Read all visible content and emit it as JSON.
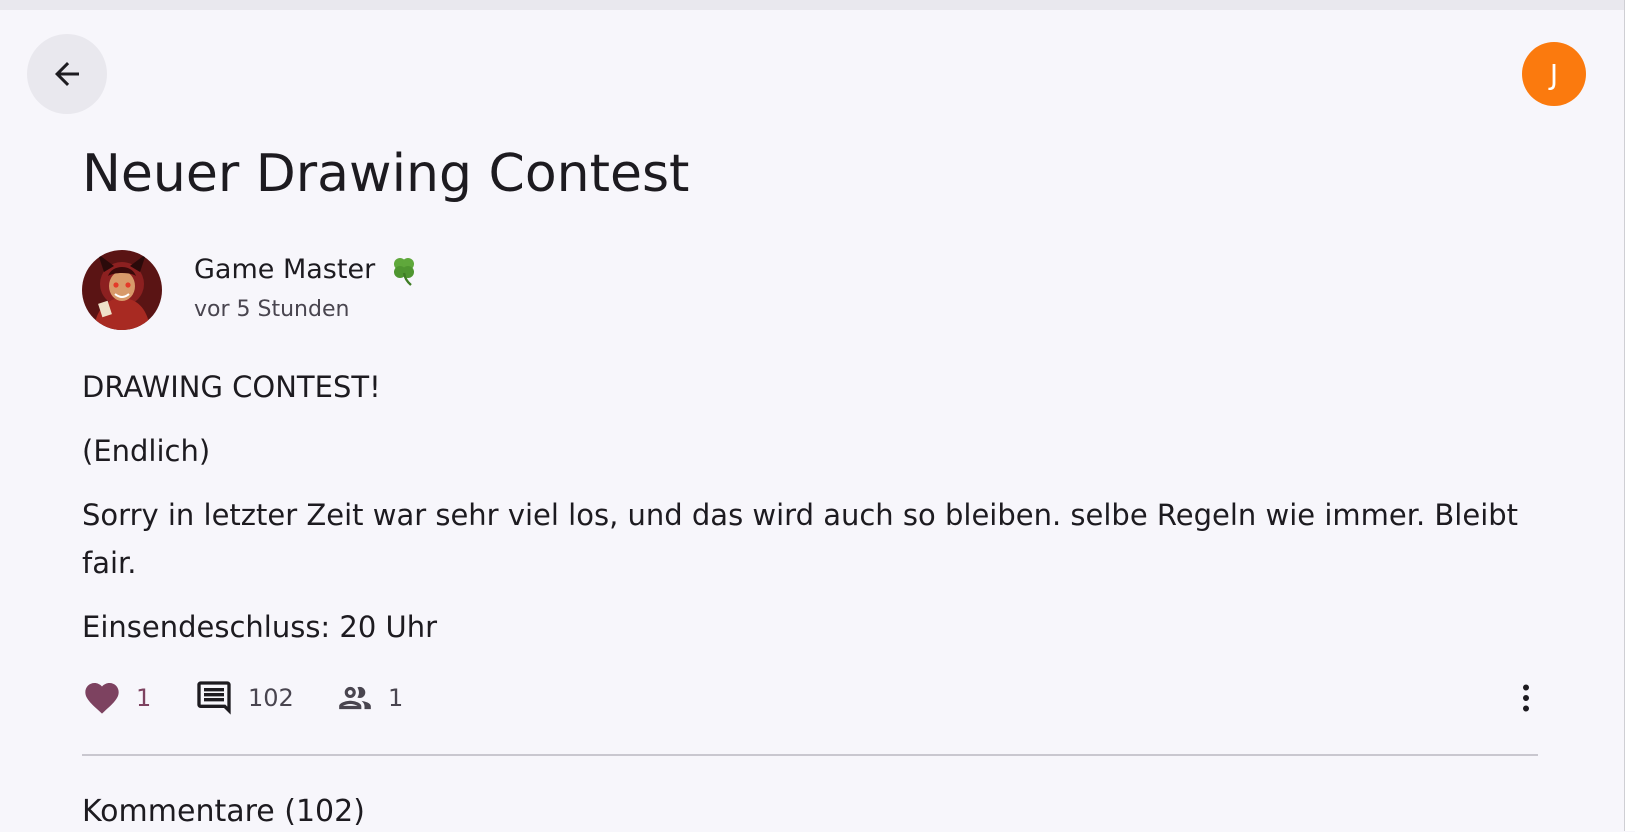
{
  "user": {
    "avatar_initial": "J",
    "avatar_color": "#fb7a0e"
  },
  "post": {
    "title": "Neuer Drawing Contest",
    "author": {
      "name": "Game Master",
      "badge_icon": "four-leaf-clover-icon"
    },
    "time": "vor 5 Stunden",
    "body": [
      "DRAWING CONTEST!",
      "(Endlich)",
      "Sorry in letzter Zeit war sehr viel los, und das wird auch so bleiben. selbe Regeln wie immer. Bleibt fair.",
      "Einsendeschluss: 20 Uhr"
    ],
    "stats": {
      "likes": "1",
      "comments": "102",
      "participants": "1",
      "like_color": "#7d4260"
    }
  },
  "comments": {
    "heading": "Kommentare (102)"
  }
}
